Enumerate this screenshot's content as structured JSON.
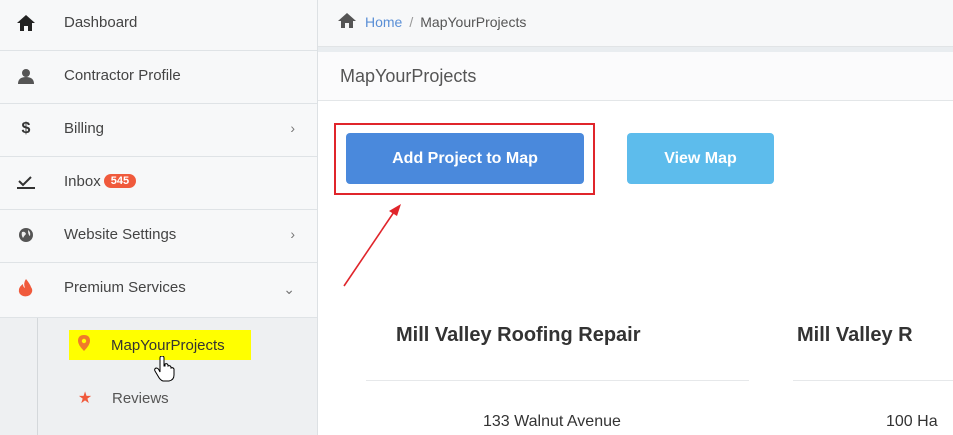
{
  "sidebar": {
    "items": [
      {
        "label": "Dashboard",
        "icon": "home-icon"
      },
      {
        "label": "Contractor Profile",
        "icon": "user-icon"
      },
      {
        "label": "Billing",
        "icon": "dollar-icon"
      },
      {
        "label": "Inbox",
        "icon": "inbox-icon",
        "badge": "545"
      },
      {
        "label": "Website Settings",
        "icon": "globe-icon"
      },
      {
        "label": "Premium Services",
        "icon": "fire-icon"
      }
    ],
    "sub_items": [
      {
        "label": "MapYourProjects",
        "icon": "map-marker-icon"
      },
      {
        "label": "Reviews",
        "icon": "star-icon"
      }
    ]
  },
  "breadcrumb": {
    "home": "Home",
    "separator": "/",
    "current": "MapYourProjects"
  },
  "page": {
    "title": "MapYourProjects"
  },
  "buttons": {
    "add_project": "Add Project to Map",
    "view_map": "View Map"
  },
  "cards": [
    {
      "title": "Mill Valley Roofing Repair",
      "address": "133 Walnut Avenue"
    },
    {
      "title": "Mill Valley R",
      "address": "100 Ha"
    }
  ],
  "colors": {
    "primary": "#4a89dc",
    "info": "#5dbcec",
    "badge": "#f05a3c",
    "highlight": "#ffff00",
    "annotation": "#e0252b"
  }
}
